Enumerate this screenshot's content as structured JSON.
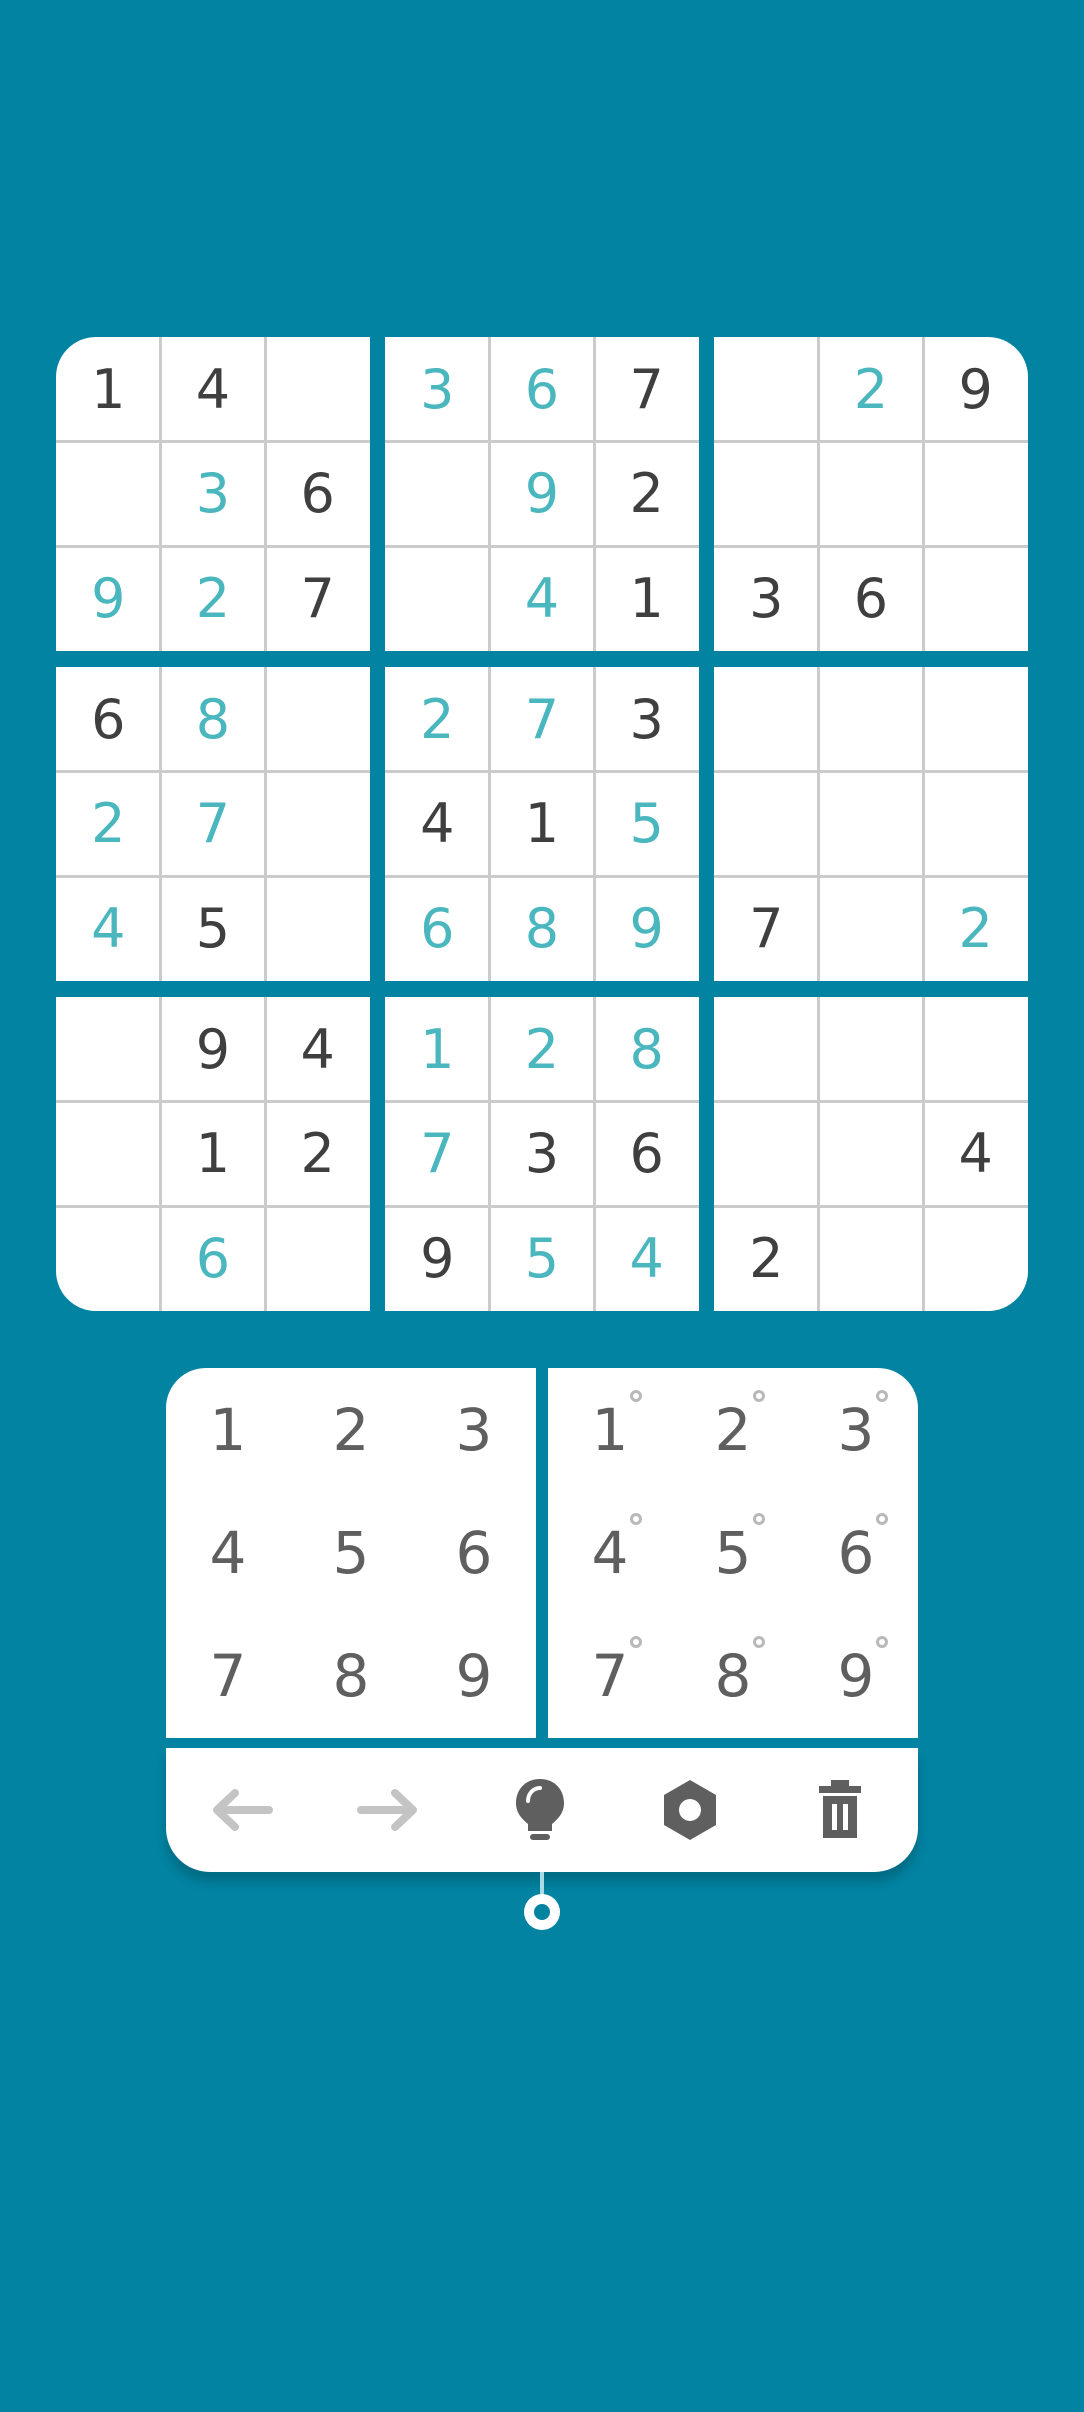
{
  "board": {
    "rows": [
      [
        "1",
        "4",
        "",
        "3",
        "6",
        "7",
        "",
        "2",
        "9"
      ],
      [
        "",
        "3",
        "6",
        "",
        "9",
        "2",
        "",
        "",
        ""
      ],
      [
        "9",
        "2",
        "7",
        "",
        "4",
        "1",
        "3",
        "6",
        ""
      ],
      [
        "6",
        "8",
        "",
        "2",
        "7",
        "3",
        "",
        "",
        ""
      ],
      [
        "2",
        "7",
        "",
        "4",
        "1",
        "5",
        "",
        "",
        ""
      ],
      [
        "4",
        "5",
        "",
        "6",
        "8",
        "9",
        "7",
        "",
        "2"
      ],
      [
        "",
        "9",
        "4",
        "1",
        "2",
        "8",
        "",
        "",
        ""
      ],
      [
        "",
        "1",
        "2",
        "7",
        "3",
        "6",
        "",
        "",
        "4"
      ],
      [
        "",
        "6",
        "",
        "9",
        "5",
        "4",
        "2",
        "",
        ""
      ]
    ],
    "user_entered": [
      [
        0,
        0,
        0,
        1,
        1,
        0,
        0,
        1,
        0
      ],
      [
        0,
        1,
        0,
        0,
        1,
        0,
        0,
        0,
        0
      ],
      [
        1,
        1,
        0,
        0,
        1,
        0,
        0,
        0,
        0
      ],
      [
        0,
        1,
        0,
        1,
        1,
        0,
        0,
        0,
        0
      ],
      [
        1,
        1,
        0,
        0,
        0,
        1,
        0,
        0,
        0
      ],
      [
        1,
        0,
        0,
        1,
        1,
        1,
        0,
        0,
        1
      ],
      [
        0,
        0,
        0,
        1,
        1,
        1,
        0,
        0,
        0
      ],
      [
        0,
        0,
        0,
        1,
        0,
        0,
        0,
        0,
        0
      ],
      [
        0,
        1,
        0,
        0,
        1,
        1,
        0,
        0,
        0
      ]
    ]
  },
  "number_pad": [
    "1",
    "2",
    "3",
    "4",
    "5",
    "6",
    "7",
    "8",
    "9"
  ],
  "notes_pad": [
    "1",
    "2",
    "3",
    "4",
    "5",
    "6",
    "7",
    "8",
    "9"
  ],
  "toolbar": [
    {
      "name": "undo-button",
      "icon": "arrow-left-icon"
    },
    {
      "name": "redo-button",
      "icon": "arrow-right-icon"
    },
    {
      "name": "hint-button",
      "icon": "lightbulb-icon"
    },
    {
      "name": "settings-button",
      "icon": "gear-icon"
    },
    {
      "name": "delete-button",
      "icon": "trash-icon"
    }
  ],
  "colors": {
    "background": "#0283a2",
    "given_digit": "#3f3f3f",
    "user_digit": "#4ab6bd",
    "pad_digit": "#5f5f5f",
    "disabled_icon": "#c4c4c4",
    "active_icon": "#5f5f5f"
  }
}
